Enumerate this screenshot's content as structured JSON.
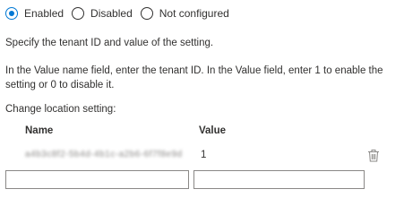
{
  "radio_group": {
    "options": [
      {
        "label": "Enabled",
        "checked": true
      },
      {
        "label": "Disabled",
        "checked": false
      },
      {
        "label": "Not configured",
        "checked": false
      }
    ]
  },
  "description": {
    "line1": "Specify the tenant ID and value of the setting.",
    "line2": "In the Value name field, enter the tenant ID. In the Value field, enter 1 to enable the setting or 0 to disable it.",
    "list_title": "Change location setting:"
  },
  "table": {
    "headers": {
      "name": "Name",
      "value": "Value"
    },
    "rows": [
      {
        "name": "a4b3c8f2-5b4d-4b1c-a2b6-6f7f8e9d",
        "value": "1"
      }
    ]
  },
  "new_row": {
    "name_value": "",
    "value_value": ""
  },
  "icons": {
    "delete": "trash-icon"
  },
  "colors": {
    "accent": "#0078d4",
    "text": "#323130",
    "border": "#8a8886"
  }
}
